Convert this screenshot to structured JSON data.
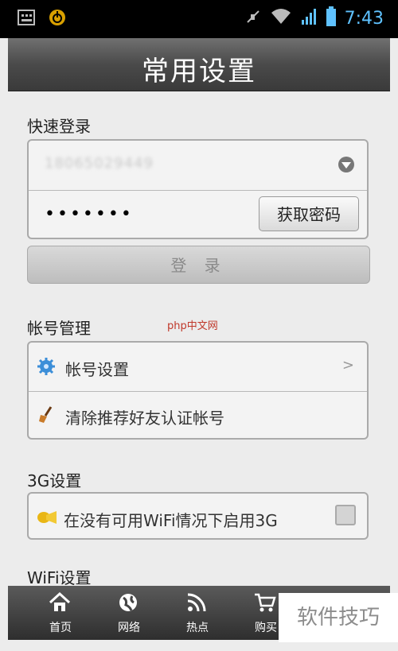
{
  "status_bar": {
    "time": "7:43"
  },
  "header": {
    "title": "常用设置"
  },
  "quick_login": {
    "section_title": "快速登录",
    "phone_value": "18065029449",
    "password_value": "•••••••",
    "get_password_label": "获取密码",
    "login_label": "登 录"
  },
  "account": {
    "section_title": "帐号管理",
    "items": [
      {
        "label": "帐号设置",
        "icon": "gear-icon"
      },
      {
        "label": "清除推荐好友认证帐号",
        "icon": "broom-icon"
      }
    ],
    "watermark": "php中文网"
  },
  "three_g": {
    "section_title": "3G设置",
    "option_label": "在没有可用WiFi情况下启用3G"
  },
  "wifi": {
    "section_title": "WiFi设置"
  },
  "bottom_nav": {
    "items": [
      {
        "label": "首页"
      },
      {
        "label": "网络"
      },
      {
        "label": "热点"
      },
      {
        "label": "购买"
      }
    ]
  },
  "overlay_watermark": "软件技巧",
  "colors": {
    "accent": "#5fc2ff",
    "title_bar": "#4a4a4a",
    "background": "#ececec"
  }
}
